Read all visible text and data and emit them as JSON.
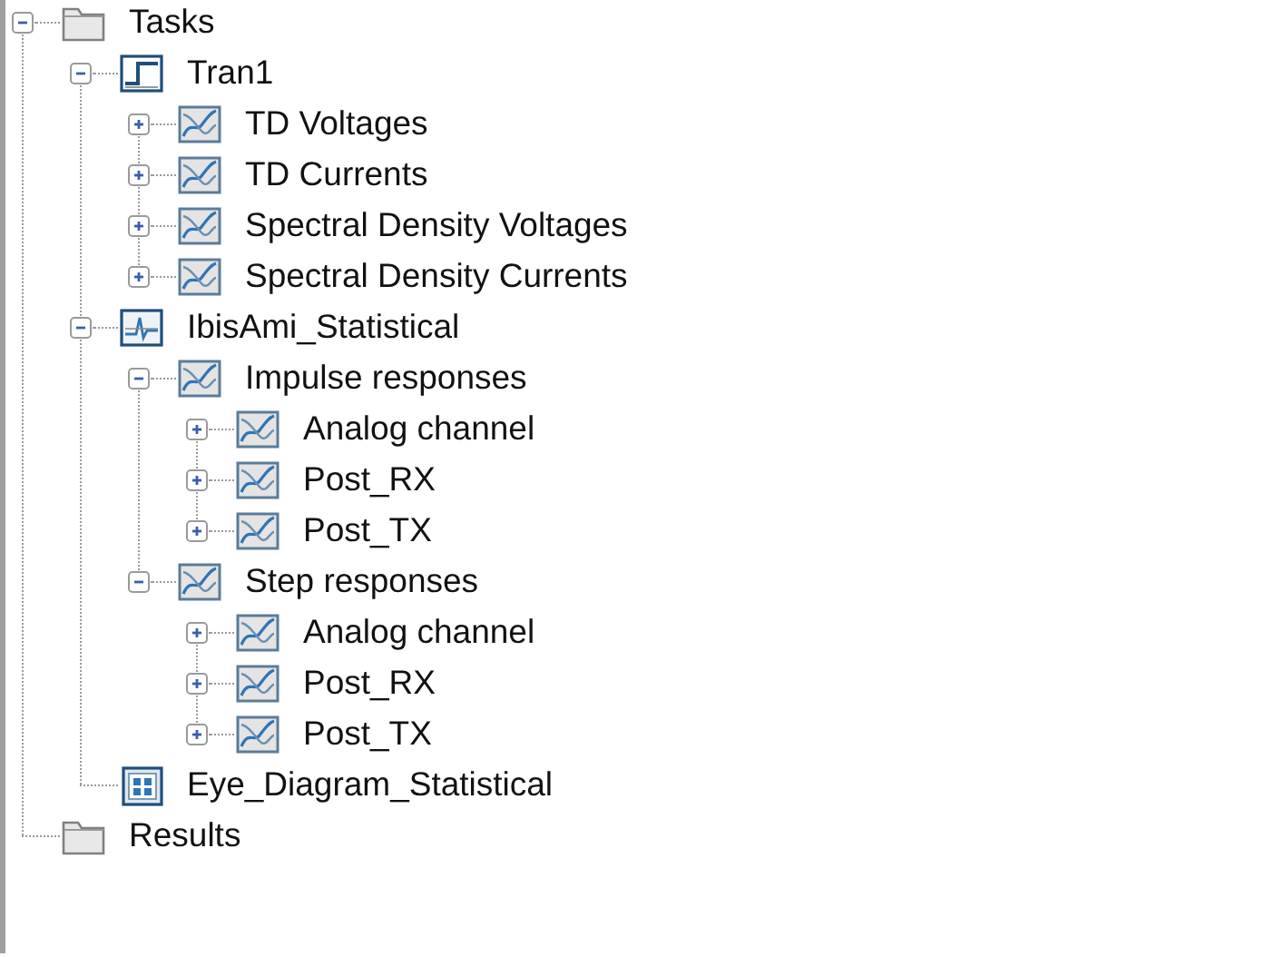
{
  "tree": [
    {
      "label": "Tasks",
      "kind": "folder",
      "expanded": true,
      "children": [
        {
          "label": "Tran1",
          "kind": "transient",
          "expanded": true,
          "children": [
            {
              "label": "TD Voltages",
              "kind": "plot",
              "expanded": false
            },
            {
              "label": "TD Currents",
              "kind": "plot",
              "expanded": false
            },
            {
              "label": "Spectral Density Voltages",
              "kind": "plot",
              "expanded": false
            },
            {
              "label": "Spectral Density Currents",
              "kind": "plot",
              "expanded": false
            }
          ]
        },
        {
          "label": "IbisAmi_Statistical",
          "kind": "statistical",
          "expanded": true,
          "children": [
            {
              "label": "Impulse responses",
              "kind": "plot",
              "expanded": true,
              "children": [
                {
                  "label": "Analog channel",
                  "kind": "plot",
                  "expanded": false
                },
                {
                  "label": "Post_RX",
                  "kind": "plot",
                  "expanded": false
                },
                {
                  "label": "Post_TX",
                  "kind": "plot",
                  "expanded": false
                }
              ]
            },
            {
              "label": "Step responses",
              "kind": "plot",
              "expanded": true,
              "children": [
                {
                  "label": "Analog channel",
                  "kind": "plot",
                  "expanded": false
                },
                {
                  "label": "Post_RX",
                  "kind": "plot",
                  "expanded": false
                },
                {
                  "label": "Post_TX",
                  "kind": "plot",
                  "expanded": false
                }
              ]
            }
          ]
        },
        {
          "label": "Eye_Diagram_Statistical",
          "kind": "eye"
        }
      ]
    },
    {
      "label": "Results",
      "kind": "folder"
    }
  ]
}
